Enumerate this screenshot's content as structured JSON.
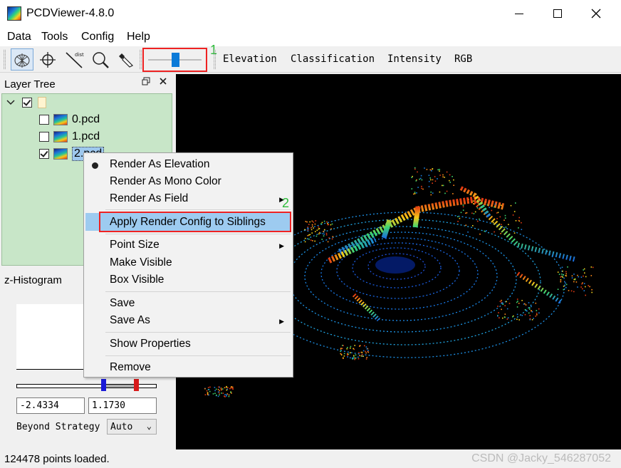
{
  "window": {
    "title": "PCDViewer-4.8.0"
  },
  "menu": [
    "Data",
    "Tools",
    "Config",
    "Help"
  ],
  "toolbar": {
    "tools": [
      "select-tool-icon",
      "crosshair-tool-icon",
      "distance-tool-icon",
      "zoom-tool-icon",
      "eraser-tool-icon"
    ],
    "distance_tool_text": "dist",
    "annotation_1": "1",
    "render_modes": [
      "Elevation",
      "Classification",
      "Intensity",
      "RGB"
    ]
  },
  "layer_tree": {
    "title": "Layer Tree",
    "files": [
      {
        "name": "0.pcd",
        "checked": false
      },
      {
        "name": "1.pcd",
        "checked": false
      },
      {
        "name": "2.pcd",
        "checked": true
      }
    ]
  },
  "histogram": {
    "title": "z-Histogram",
    "min_value": "-2.4334",
    "max_value": "1.1730",
    "beyond_label": "Beyond Strategy",
    "beyond_value": "Auto"
  },
  "context_menu": {
    "items": [
      "Render As Elevation",
      "Render As Mono Color",
      "Render As Field",
      "Apply Render Config to Siblings",
      "Point Size",
      "Make Visible",
      "Box Visible",
      "Save",
      "Save As",
      "Show Properties",
      "Remove"
    ],
    "annotation_2": "2"
  },
  "status": {
    "text": "124478 points loaded.",
    "watermark": "CSDN @Jacky_546287052"
  },
  "colors": {
    "tree_bg": "#c8e6c8",
    "highlight": "#9dcbf0",
    "annotation_box": "#e22222",
    "annotation_number": "#2dbb3a",
    "slider": "#0a7ad8"
  }
}
